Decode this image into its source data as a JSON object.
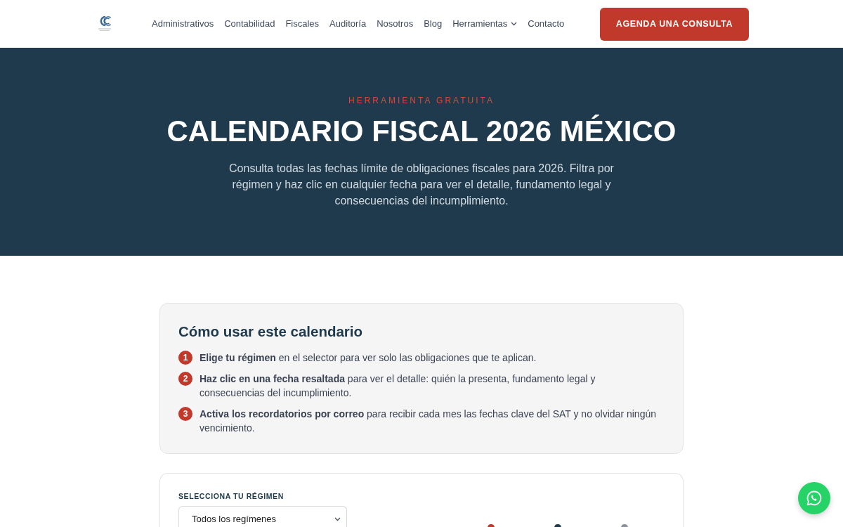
{
  "navbar": {
    "links": [
      {
        "label": "Administrativos",
        "kind": "link"
      },
      {
        "label": "Contabilidad",
        "kind": "link"
      },
      {
        "label": "Fiscales",
        "kind": "link"
      },
      {
        "label": "Auditoría",
        "kind": "link"
      },
      {
        "label": "Nosotros",
        "kind": "link"
      },
      {
        "label": "Blog",
        "kind": "link"
      },
      {
        "label": "Herramientas",
        "kind": "dropdown"
      },
      {
        "label": "Contacto",
        "kind": "link"
      }
    ],
    "cta": "AGENDA UNA CONSULTA"
  },
  "hero": {
    "eyebrow": "HERRAMIENTA GRATUITA",
    "title": "CALENDARIO FISCAL 2026 MÉXICO",
    "description": "Consulta todas las fechas límite de obligaciones fiscales para 2026. Filtra por régimen y haz clic en cualquier fecha para ver el detalle, fundamento legal y consecuencias del incumplimiento."
  },
  "instructions": {
    "title": "Cómo usar este calendario",
    "steps": [
      {
        "number": "1",
        "text": "**Elige tu régimen** en el selector para ver solo las obligaciones que te aplican."
      },
      {
        "number": "2",
        "text": "**Haz clic en una fecha resaltada** para ver el detalle: quién la presenta, fundamento legal y consecuencias del incumplimiento."
      },
      {
        "number": "3",
        "text": "**Activa los recordatorios por correo** para recibir cada mes las fechas clave del SAT y no olvidar ningún vencimiento."
      }
    ]
  },
  "filter": {
    "label": "SELECCIONA TU RÉGIMEN",
    "select_value": "Todos los regímenes",
    "legend": [
      {
        "color": "#c0392b"
      },
      {
        "color": "#1e3a4c"
      },
      {
        "color": "#8a9099"
      }
    ]
  }
}
